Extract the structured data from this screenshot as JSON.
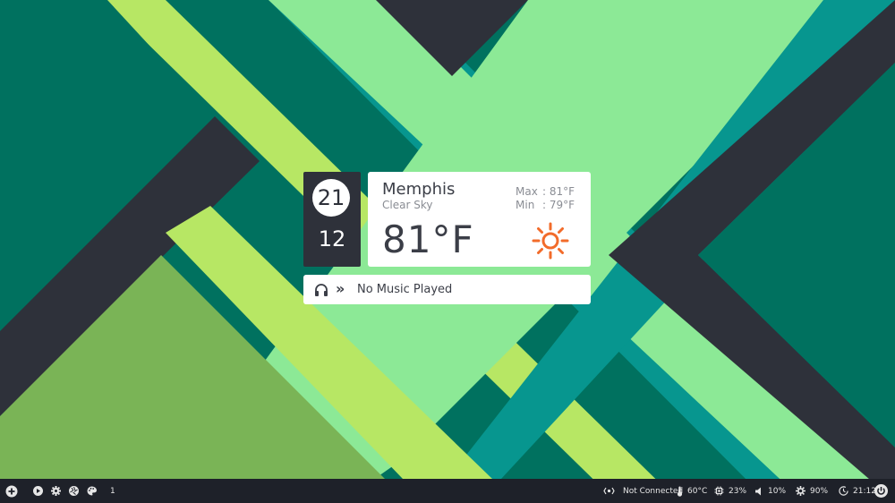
{
  "colors": {
    "dark": "#2e313a",
    "teal": "#00715f",
    "cyan_teal": "#07968f",
    "light_green": "#8ce996",
    "lime": "#b7e764",
    "olive_green": "#7ab456",
    "panel_bg": "#1e2129",
    "sun": "#f26b2a"
  },
  "clock": {
    "hour": "21",
    "minute": "12"
  },
  "weather": {
    "city": "Memphis",
    "condition": "Clear Sky",
    "max_label": "Max",
    "max_value": ": 81°F",
    "min_label": "Min",
    "min_value": ": 79°F",
    "temperature": "81°F",
    "icon": "sun-icon"
  },
  "music": {
    "icon": "headphones-icon",
    "title": "No Music Played"
  },
  "panel": {
    "left": {
      "icons": [
        "add-icon",
        "play-icon",
        "gear-icon",
        "aperture-icon",
        "palette-icon"
      ],
      "workspace": "1"
    },
    "right": {
      "network": "Not Connected",
      "temperature": "60°C",
      "cpu": "23%",
      "volume": "10%",
      "brightness": "90%",
      "time": "21:12"
    }
  }
}
